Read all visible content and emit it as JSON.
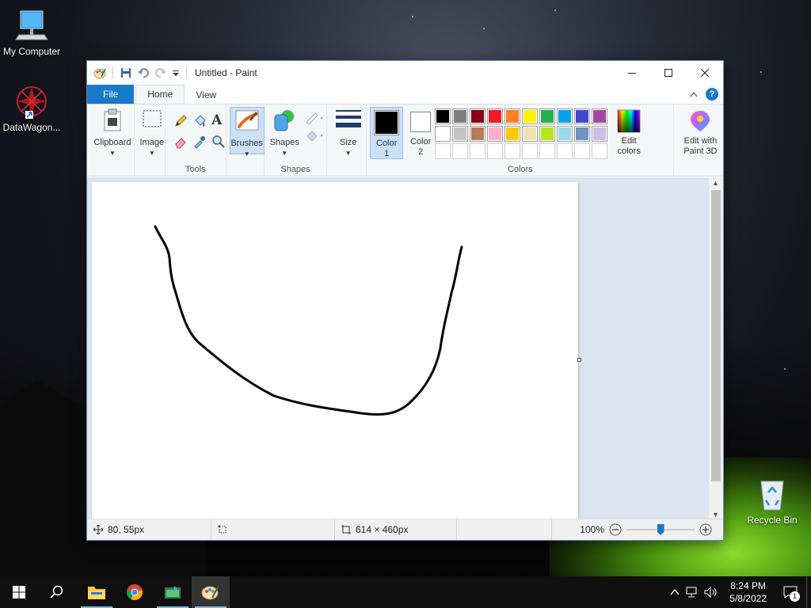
{
  "desktop": {
    "icons": [
      {
        "label": "My Computer"
      },
      {
        "label": "DataWagon..."
      },
      {
        "label": "Recycle Bin"
      }
    ]
  },
  "window": {
    "title": "Untitled - Paint",
    "tabs": {
      "file": "File",
      "home": "Home",
      "view": "View"
    },
    "ribbon": {
      "clipboard": "Clipboard",
      "image": "Image",
      "tools_label": "Tools",
      "brushes": "Brushes",
      "shapes": "Shapes",
      "shapes_label": "Shapes",
      "size": "Size",
      "color1_a": "Color",
      "color1_b": "1",
      "color2_a": "Color",
      "color2_b": "2",
      "colors_label": "Colors",
      "edit_colors_a": "Edit",
      "edit_colors_b": "colors",
      "paint3d_a": "Edit with",
      "paint3d_b": "Paint 3D",
      "text_tool_glyph": "A",
      "color1_value": "#000000",
      "color2_value": "#ffffff",
      "palette": [
        "#000000",
        "#7f7f7f",
        "#880015",
        "#ed1c24",
        "#ff7f27",
        "#fff200",
        "#22b14c",
        "#00a2e8",
        "#3f48cc",
        "#a349a4",
        "#ffffff",
        "#c3c3c3",
        "#b97a57",
        "#ffaec9",
        "#ffc90e",
        "#efe4b0",
        "#b5e61d",
        "#99d9ea",
        "#7092be",
        "#c8bfe7",
        "",
        "",
        "",
        "",
        "",
        "",
        "",
        "",
        "",
        ""
      ]
    },
    "status": {
      "cursor": "80, 55px",
      "canvas_size": "614 × 460px",
      "zoom": "100%"
    }
  },
  "taskbar": {
    "time": "8:24 PM",
    "date": "5/8/2022",
    "notification_count": "1"
  }
}
